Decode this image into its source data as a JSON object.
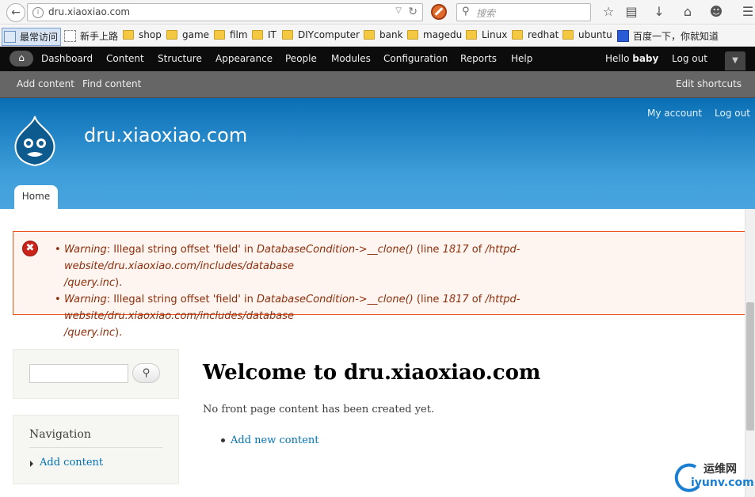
{
  "browser": {
    "url": "dru.xiaoxiao.com",
    "search_placeholder": "搜索"
  },
  "bookmarks": [
    {
      "label": "最常访问",
      "icon": "most-visited-icon"
    },
    {
      "label": "新手上路",
      "icon": "getting-started-icon"
    },
    {
      "label": "shop",
      "icon": "folder-icon"
    },
    {
      "label": "game",
      "icon": "folder-icon"
    },
    {
      "label": "film",
      "icon": "folder-icon"
    },
    {
      "label": "IT",
      "icon": "folder-icon"
    },
    {
      "label": "DIYcomputer",
      "icon": "folder-icon"
    },
    {
      "label": "bank",
      "icon": "folder-icon"
    },
    {
      "label": "magedu",
      "icon": "folder-icon"
    },
    {
      "label": "Linux",
      "icon": "folder-icon"
    },
    {
      "label": "redhat",
      "icon": "folder-icon"
    },
    {
      "label": "ubuntu",
      "icon": "folder-icon"
    },
    {
      "label": "百度一下，你就知道",
      "icon": "baidu-paw-icon"
    }
  ],
  "toolbar": {
    "items": [
      "Dashboard",
      "Content",
      "Structure",
      "Appearance",
      "People",
      "Modules",
      "Configuration",
      "Reports",
      "Help"
    ],
    "hello_prefix": "Hello ",
    "username": "baby",
    "logout": "Log out"
  },
  "shortcuts": {
    "add_content": "Add content",
    "find_content": "Find content",
    "edit_shortcuts": "Edit shortcuts"
  },
  "header": {
    "site_name": "dru.xiaoxiao.com",
    "my_account": "My account",
    "log_out": "Log out",
    "tab_home": "Home"
  },
  "messages": [
    {
      "type": "Warning",
      "text1": ": Illegal string offset 'field' in ",
      "func": "DatabaseCondition->__clone()",
      "text2": " (line ",
      "line": "1817",
      "text3": " of ",
      "file_a": "/httpd-website/dru.xiaoxiao.com/includes/database",
      "file_b": "/query.inc",
      "text4": ")."
    },
    {
      "type": "Warning",
      "text1": ": Illegal string offset 'field' in ",
      "func": "DatabaseCondition->__clone()",
      "text2": " (line ",
      "line": "1817",
      "text3": " of ",
      "file_a": "/httpd-website/dru.xiaoxiao.com/includes/database",
      "file_b": "/query.inc",
      "text4": ")."
    }
  ],
  "sidebar": {
    "search_button_icon": "search-icon",
    "nav_title": "Navigation",
    "nav_link": "Add content"
  },
  "main": {
    "title": "Welcome to dru.xiaoxiao.com",
    "no_content": "No front page content has been created yet.",
    "add_new": "Add new content"
  },
  "watermark": {
    "top": "运维网",
    "bottom": "iyunv.com"
  },
  "colors": {
    "toolbar_bg": "#0c0c0c",
    "shortcut_bg": "#666666",
    "header_blue": "#0a6fb5",
    "error_border": "#ed541d",
    "error_text": "#8c2e0b",
    "link": "#0071b3"
  }
}
